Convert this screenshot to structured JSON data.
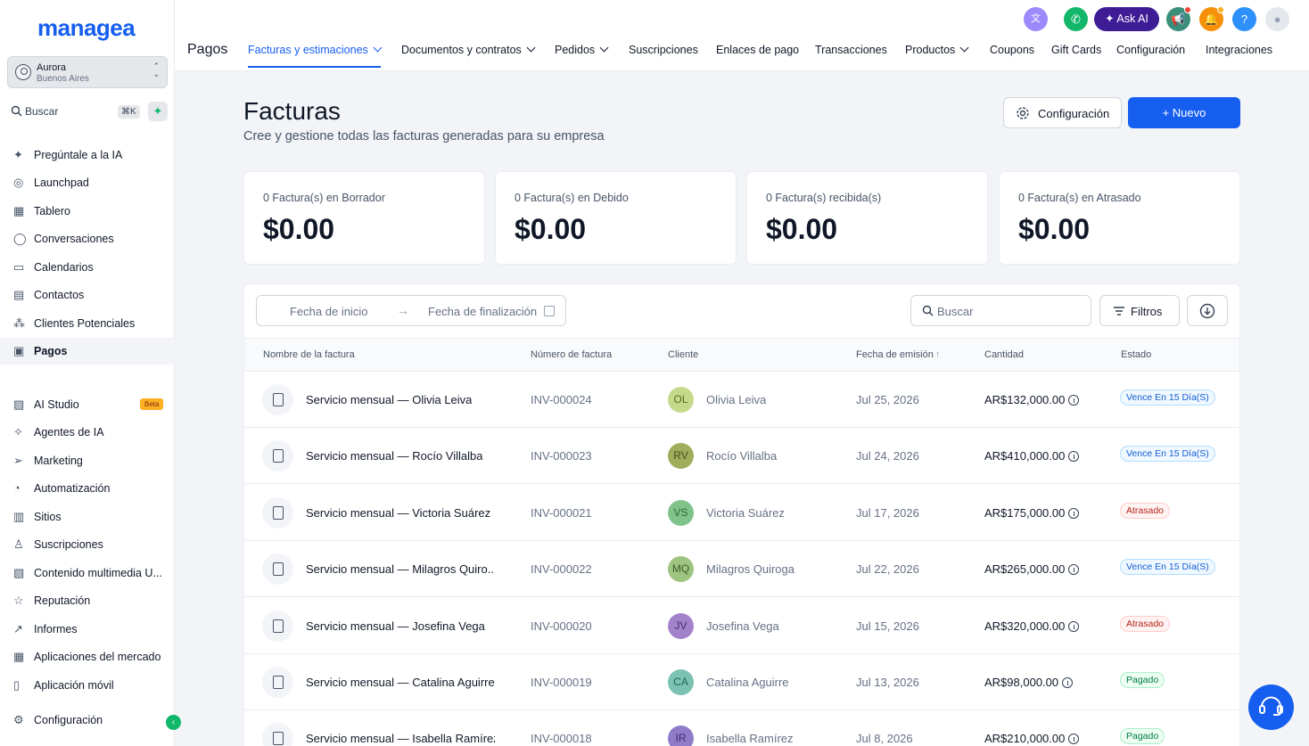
{
  "brand": {
    "logo": "managea"
  },
  "location": {
    "name": "Aurora",
    "sub": "Buenos Aires"
  },
  "sidebar": {
    "search_label": "Buscar",
    "search_shortcut": "⌘K",
    "items": [
      {
        "label": "Pregúntale a la IA",
        "icon": "sparkles-icon"
      },
      {
        "label": "Launchpad",
        "icon": "rocket-icon"
      },
      {
        "label": "Tablero",
        "icon": "dashboard-icon"
      },
      {
        "label": "Conversaciones",
        "icon": "chat-bubble-icon"
      },
      {
        "label": "Calendarios",
        "icon": "calendar-icon"
      },
      {
        "label": "Contactos",
        "icon": "contacts-icon"
      },
      {
        "label": "Clientes Potenciales",
        "icon": "pipeline-icon"
      },
      {
        "label": "Pagos",
        "icon": "payments-icon",
        "active": true
      },
      {
        "label": "AI Studio",
        "icon": "ai-studio-icon",
        "badge": "Beta"
      },
      {
        "label": "Agentes de IA",
        "icon": "ai-agent-icon"
      },
      {
        "label": "Marketing",
        "icon": "send-icon"
      },
      {
        "label": "Automatización",
        "icon": "automation-icon"
      },
      {
        "label": "Sitios",
        "icon": "sites-icon"
      },
      {
        "label": "Suscripciones",
        "icon": "membership-icon"
      },
      {
        "label": "Contenido multimedia U...",
        "icon": "media-icon"
      },
      {
        "label": "Reputación",
        "icon": "star-icon"
      },
      {
        "label": "Informes",
        "icon": "trend-icon"
      },
      {
        "label": "Aplicaciones del mercado",
        "icon": "apps-icon"
      },
      {
        "label": "Aplicación móvil",
        "icon": "mobile-icon"
      },
      {
        "label": "Configuración",
        "icon": "gear-icon"
      }
    ]
  },
  "header": {
    "section": "Pagos",
    "ask_ai": "Ask AI",
    "help": "?",
    "tabs": [
      {
        "label": "Facturas y estimaciones",
        "dropdown": true,
        "active": true
      },
      {
        "label": "Documentos y contratos",
        "dropdown": true
      },
      {
        "label": "Pedidos",
        "dropdown": true
      },
      {
        "label": "Suscripciones"
      },
      {
        "label": "Enlaces de pago"
      },
      {
        "label": "Transacciones"
      },
      {
        "label": "Productos",
        "dropdown": true
      },
      {
        "label": "Coupons"
      },
      {
        "label": "Gift Cards"
      },
      {
        "label": "Configuración"
      },
      {
        "label": "Integraciones"
      }
    ]
  },
  "page": {
    "title": "Facturas",
    "subtitle": "Cree y gestione todas las facturas generadas para su empresa",
    "config_button": "Configuración",
    "new_button": "+ Nuevo"
  },
  "stats": [
    {
      "label": "0 Factura(s) en Borrador",
      "value": "$0.00"
    },
    {
      "label": "0 Factura(s) en Debido",
      "value": "$0.00"
    },
    {
      "label": "0 Factura(s) recibida(s)",
      "value": "$0.00"
    },
    {
      "label": "0 Factura(s) en Atrasado",
      "value": "$0.00"
    }
  ],
  "filters": {
    "start_placeholder": "Fecha de inicio",
    "end_placeholder": "Fecha de finalización",
    "search_placeholder": "Buscar",
    "filters_label": "Filtros"
  },
  "table": {
    "columns": [
      "Nombre de la factura",
      "Número de factura",
      "Cliente",
      "Fecha de emisión",
      "Cantidad",
      "Estado"
    ],
    "rows": [
      {
        "name": "Servicio mensual — Olivia Leiva",
        "number": "INV-000024",
        "initials": "OL",
        "client": "Olivia Leiva",
        "date": "Jul 25, 2026",
        "amount": "AR$132,000.00",
        "status": "Vence En 15 Día(S)",
        "status_type": "vence",
        "avatar_bg": "#c5d98a",
        "avatar_fg": "#5c6b1f"
      },
      {
        "name": "Servicio mensual — Rocío Villalba",
        "number": "INV-000023",
        "initials": "RV",
        "client": "Rocío Villalba",
        "date": "Jul 24, 2026",
        "amount": "AR$410,000.00",
        "status": "Vence En 15 Día(S)",
        "status_type": "vence",
        "avatar_bg": "#a0ad5c",
        "avatar_fg": "#4a5220"
      },
      {
        "name": "Servicio mensual — Victoria Suárez",
        "number": "INV-000021",
        "initials": "VS",
        "client": "Victoria Suárez",
        "date": "Jul 17, 2026",
        "amount": "AR$175,000.00",
        "status": "Atrasado",
        "status_type": "atrasado",
        "avatar_bg": "#7fc28a",
        "avatar_fg": "#2f6b3a"
      },
      {
        "name": "Servicio mensual — Milagros Quiro...",
        "number": "INV-000022",
        "initials": "MQ",
        "client": "Milagros Quiroga",
        "date": "Jul 22, 2026",
        "amount": "AR$265,000.00",
        "status": "Vence En 15 Día(S)",
        "status_type": "vence",
        "avatar_bg": "#9ec482",
        "avatar_fg": "#3d5e29"
      },
      {
        "name": "Servicio mensual — Josefina Vega",
        "number": "INV-000020",
        "initials": "JV",
        "client": "Josefina Vega",
        "date": "Jul 15, 2026",
        "amount": "AR$320,000.00",
        "status": "Atrasado",
        "status_type": "atrasado",
        "avatar_bg": "#a283c9",
        "avatar_fg": "#4b2e73"
      },
      {
        "name": "Servicio mensual — Catalina Aguirre",
        "number": "INV-000019",
        "initials": "CA",
        "client": "Catalina Aguirre",
        "date": "Jul 13, 2026",
        "amount": "AR$98,000.00",
        "status": "Pagado",
        "status_type": "pagado",
        "avatar_bg": "#7cc2b3",
        "avatar_fg": "#24655a"
      },
      {
        "name": "Servicio mensual — Isabella Ramírez",
        "number": "INV-000018",
        "initials": "IR",
        "client": "Isabella Ramírez",
        "date": "Jul 8, 2026",
        "amount": "AR$210,000.00",
        "status": "Pagado",
        "status_type": "pagado",
        "avatar_bg": "#8f7cc9",
        "avatar_fg": "#3f2e73"
      }
    ]
  },
  "colors": {
    "accent": "#155eef",
    "ask_ai": "#3e1c96",
    "phone": "#12b76a",
    "notify": "#f79009"
  }
}
